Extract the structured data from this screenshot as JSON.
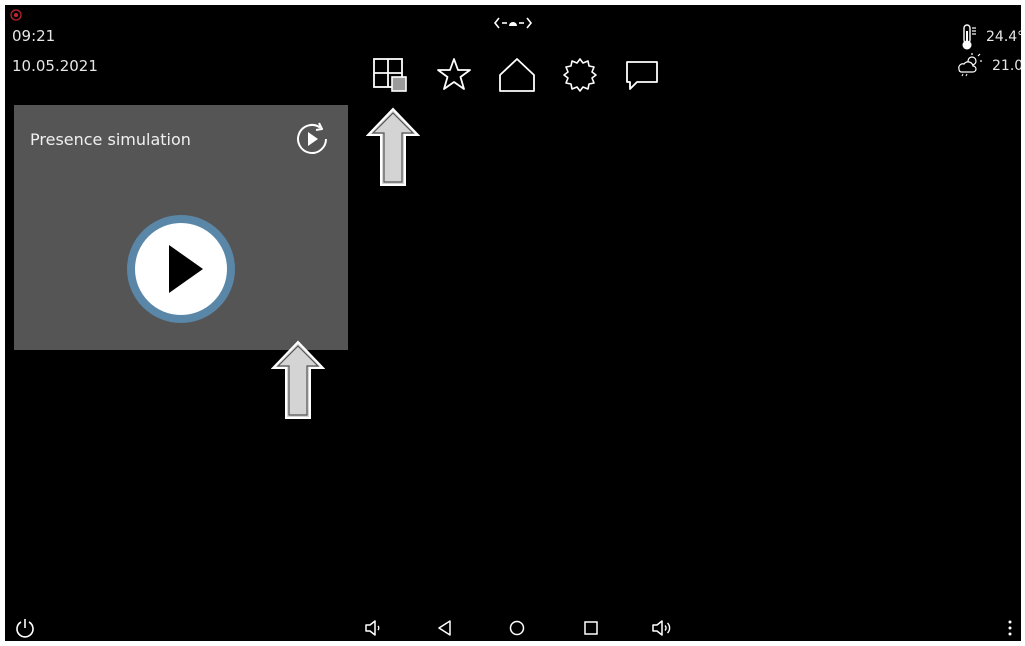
{
  "status": {
    "time": "09:21",
    "date": "10.05.2021",
    "indicator": "recording-dot-icon"
  },
  "header": {
    "logo": "(-●-)",
    "nav_icons": [
      "tiles-icon",
      "star-icon",
      "home-icon",
      "gear-icon",
      "chat-icon"
    ]
  },
  "weather": {
    "indoor_temp": "24.4°",
    "outdoor_temp": "21.0°",
    "indoor_icon": "thermometer-icon",
    "outdoor_icon": "partly-cloudy-icon"
  },
  "card": {
    "title": "Presence simulation",
    "corner_icon": "replay-icon",
    "main_icon": "play-icon"
  },
  "bottom_bar": {
    "icons": [
      "power-icon",
      "volume-down-icon",
      "back-icon",
      "home-circle-icon",
      "recents-icon",
      "volume-up-icon",
      "more-icon"
    ]
  },
  "colors": {
    "background": "#000000",
    "card": "#555555",
    "play_ring": "#5a87a8",
    "text": "#e6e6e6",
    "status_dot": "#c0262d"
  }
}
